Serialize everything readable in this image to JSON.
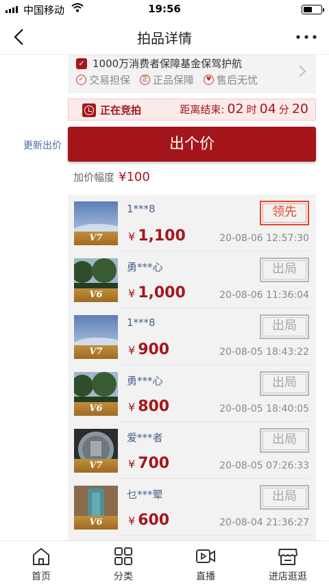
{
  "status_bar": {
    "carrier": "中国移动",
    "time": "19:56"
  },
  "nav": {
    "title": "拍品详情"
  },
  "guarantee": {
    "headline": "1000万消费者保障基金保驾护航",
    "items": [
      {
        "label": "交易担保",
        "icon": "shield-check-icon"
      },
      {
        "label": "正品保障",
        "icon": "genuine-icon"
      },
      {
        "label": "售后无忧",
        "icon": "thumbs-up-icon"
      }
    ]
  },
  "auction": {
    "status": "正在竞拍",
    "countdown_label": "距离结束:",
    "hours": "02",
    "hours_unit": "时",
    "minutes": "04",
    "minutes_unit": "分",
    "seconds": "20"
  },
  "update_link": "更新出价",
  "bid_button": "出个价",
  "increment": {
    "label": "加价幅度",
    "currency": "¥",
    "value": "100"
  },
  "bids": [
    {
      "user": "1***8",
      "level": "V7",
      "currency": "¥",
      "price": "1,100",
      "time": "20-08-06 12:57:30",
      "tag": "领先",
      "avatar": "sky"
    },
    {
      "user": "勇***心",
      "level": "V6",
      "currency": "¥",
      "price": "1,000",
      "time": "20-08-06 11:36:04",
      "tag": "出局",
      "avatar": "trees"
    },
    {
      "user": "1***8",
      "level": "V7",
      "currency": "¥",
      "price": "900",
      "time": "20-08-05 18:43:22",
      "tag": "出局",
      "avatar": "sky"
    },
    {
      "user": "勇***心",
      "level": "V6",
      "currency": "¥",
      "price": "800",
      "time": "20-08-05 18:40:05",
      "tag": "出局",
      "avatar": "trees"
    },
    {
      "user": "爱***者",
      "level": "V7",
      "currency": "¥",
      "price": "700",
      "time": "20-08-05 07:26:33",
      "tag": "出局",
      "avatar": "coin"
    },
    {
      "user": "乜***翚",
      "level": "V6",
      "currency": "¥",
      "price": "600",
      "time": "20-08-04 21:36:27",
      "tag": "出局",
      "avatar": "jade"
    }
  ],
  "tabbar": [
    {
      "label": "首页",
      "icon": "home-icon"
    },
    {
      "label": "分类",
      "icon": "category-icon"
    },
    {
      "label": "直播",
      "icon": "live-video-icon"
    },
    {
      "label": "进店逛逛",
      "icon": "store-icon"
    }
  ],
  "colors": {
    "accent": "#a5161b",
    "lead_tag": "#e2472a",
    "user_name": "#4a5f8c"
  }
}
